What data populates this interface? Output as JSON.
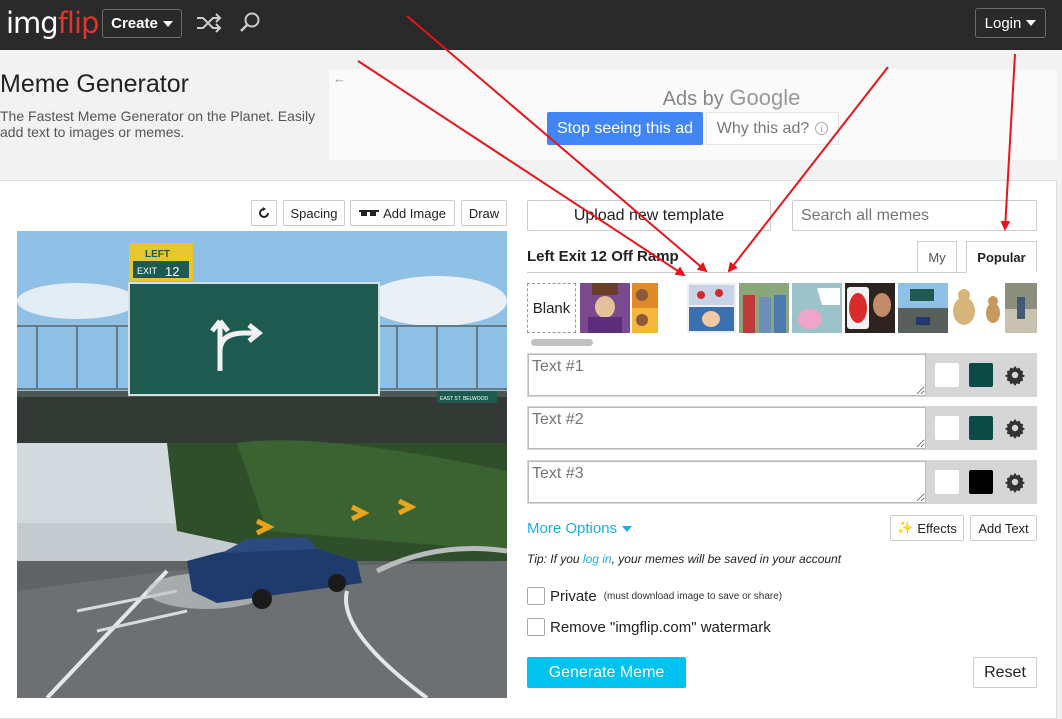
{
  "header": {
    "logo_part1": "img",
    "logo_part2": "flip",
    "create_label": "Create",
    "login_label": "Login"
  },
  "page": {
    "title": "Meme Generator",
    "subtitle": "The Fastest Meme Generator on the Planet. Easily add text to images or memes."
  },
  "ad": {
    "ads_by": "Ads by",
    "google": "Google",
    "stop_label": "Stop seeing this ad",
    "why_label": "Why this ad?"
  },
  "tools": {
    "spacing_label": "Spacing",
    "add_image_label": "Add Image",
    "draw_label": "Draw"
  },
  "templates": {
    "upload_label": "Upload new template",
    "search_placeholder": "Search all memes",
    "current_name": "Left Exit 12 Off Ramp",
    "tab_my": "My",
    "tab_popular": "Popular",
    "blank_label": "Blank"
  },
  "meme_image": {
    "sign_left": "LEFT",
    "sign_exit": "EXIT",
    "sign_num": "12",
    "small_sign": "EAST ST. BELWOOD"
  },
  "text_boxes": [
    {
      "placeholder": "Text #1",
      "outline_color": "#0b4a45"
    },
    {
      "placeholder": "Text #2",
      "outline_color": "#0b4a45"
    },
    {
      "placeholder": "Text #3",
      "outline_color": "#000000"
    }
  ],
  "options": {
    "more_options_label": "More Options",
    "effects_label": "Effects",
    "add_text_label": "Add Text",
    "tip_prefix": "Tip: If you ",
    "tip_link": "log in",
    "tip_suffix": ", your memes will be saved in your account",
    "private_label": "Private",
    "private_note": "(must download image to save or share)",
    "watermark_label": "Remove \"imgflip.com\" watermark",
    "generate_label": "Generate Meme",
    "reset_label": "Reset"
  },
  "colors": {
    "accent": "#00c3f2",
    "link": "#19aee4",
    "google_blue": "#4285f4",
    "logo_red": "#e4332d",
    "annotation_red": "#e8141b"
  }
}
